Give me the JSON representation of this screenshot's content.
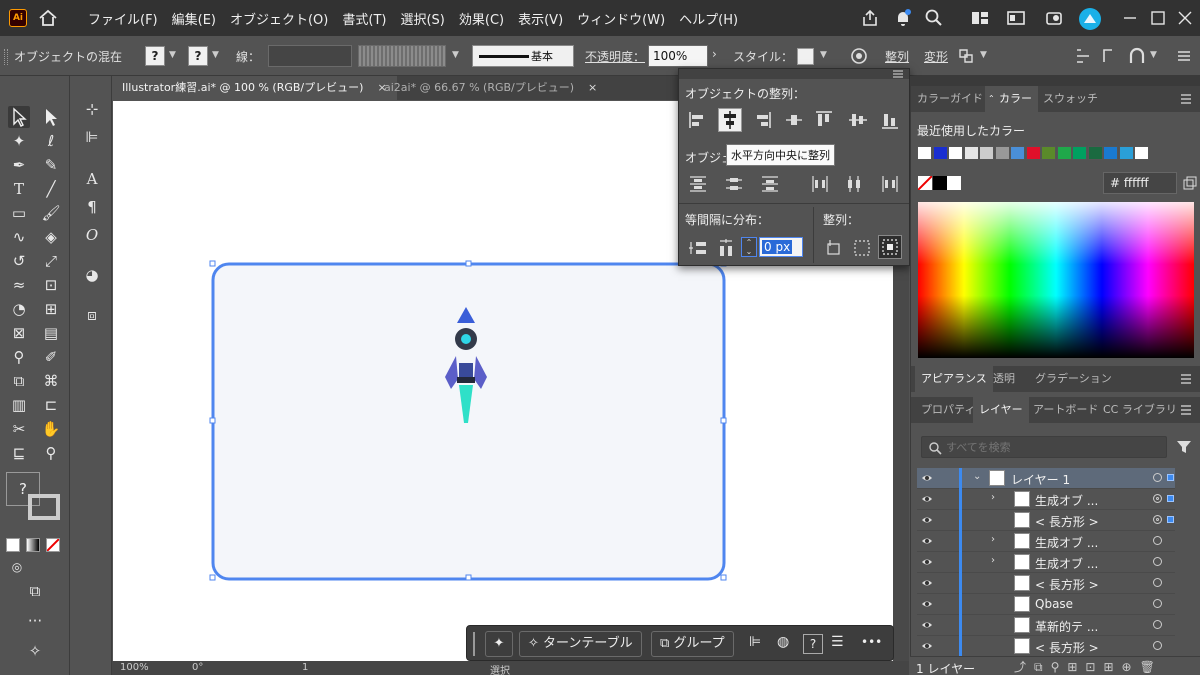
{
  "app": {
    "logo": "Ai",
    "menu": [
      "ファイル(F)",
      "編集(E)",
      "オブジェクト(O)",
      "書式(T)",
      "選択(S)",
      "効果(C)",
      "表示(V)",
      "ウィンドウ(W)",
      "ヘルプ(H)"
    ]
  },
  "controlbar": {
    "mode_label": "オブジェクトの混在",
    "stroke_label": "線：",
    "brush_label": "基本",
    "opacity_label": "不透明度：",
    "opacity_value": "100%",
    "style_label": "スタイル：",
    "align_label": "整列",
    "transform_label": "変形",
    "unknown_glyph": "?"
  },
  "tabs": [
    {
      "label": "Illustrator練習.ai* @ 100 % (RGB/プレビュー)",
      "close": "×"
    },
    {
      "label": "ai2ai* @ 66.67 % (RGB/プレビュー)",
      "close": "×"
    }
  ],
  "align_panel": {
    "title": "オブジェクトの整列：",
    "distribute_obj_label": "オブジェ",
    "tooltip": "水平方向中央に整列",
    "distribute_spacing_label": "等間隔に分布：",
    "align_to_label": "整列：",
    "spacing_value": "0 px"
  },
  "color_panel": {
    "tabs": [
      "カラーガイド",
      "カラー",
      "スウォッチ"
    ],
    "active_tab": "カラー",
    "recent_label": "最近使用したカラー",
    "hash": "#",
    "hex_value": "ffffff",
    "recent_colors": [
      "#ffffff",
      "#1a2fd0",
      "#ffffff",
      "#e6e6e6",
      "#cccccc",
      "#999999",
      "#4a8fd8",
      "#e0102a",
      "#5a8a2a",
      "#1fa84a",
      "#00a060",
      "#1a6a40",
      "#1a7ad0",
      "#2a9fd8",
      "#ffffff"
    ]
  },
  "appearance_tabs": [
    "アピアランス",
    "透明",
    "グラデーション"
  ],
  "layers_tabs": [
    "プロパティ",
    "レイヤー",
    "アートボード",
    "CC ライブラリ"
  ],
  "layers_active_tab": "レイヤー",
  "layers": {
    "search_placeholder": "すべてを検索",
    "rows": [
      {
        "name": "レイヤー 1",
        "expanded": true,
        "level": 0,
        "has_arrow": true,
        "target": "single",
        "selected_sq": true
      },
      {
        "name": "生成オブ ...",
        "level": 1,
        "has_arrow": true,
        "target": "double",
        "selected_sq": true
      },
      {
        "name": "< 長方形 >",
        "level": 1,
        "has_arrow": false,
        "target": "double",
        "selected_sq": true
      },
      {
        "name": "生成オブ ...",
        "level": 1,
        "has_arrow": true,
        "target": "single",
        "selected_sq": false
      },
      {
        "name": "生成オブ ...",
        "level": 1,
        "has_arrow": true,
        "target": "single",
        "selected_sq": false
      },
      {
        "name": "< 長方形 >",
        "level": 1,
        "has_arrow": false,
        "target": "single",
        "selected_sq": false
      },
      {
        "name": "Qbase",
        "level": 1,
        "has_arrow": false,
        "target": "single",
        "selected_sq": false
      },
      {
        "name": "革新的テ ...",
        "level": 1,
        "has_arrow": false,
        "target": "single",
        "selected_sq": false
      },
      {
        "name": "< 長方形 >",
        "level": 1,
        "has_arrow": false,
        "target": "single",
        "selected_sq": false
      }
    ],
    "footer_label": "1 レイヤー"
  },
  "context_bar": {
    "turntable_label": "ターンテーブル",
    "group_label": "グループ",
    "question": "?",
    "more": "•••"
  },
  "status": {
    "zoom": "100%",
    "rotation": "0°",
    "artboard_index": "1",
    "tool_label": "選択"
  },
  "colors": {
    "menubar_bg": "#323232",
    "panel_bg": "#535353",
    "accent_blue": "#3c8af0",
    "selection_stroke": "#4f86ef",
    "artboard_fill": "#f4f6fa"
  },
  "icons": [
    "home-icon",
    "share-icon",
    "bell-icon",
    "search-icon",
    "arrange-icon",
    "screen-icon",
    "plugin-icon",
    "avatar-icon"
  ]
}
